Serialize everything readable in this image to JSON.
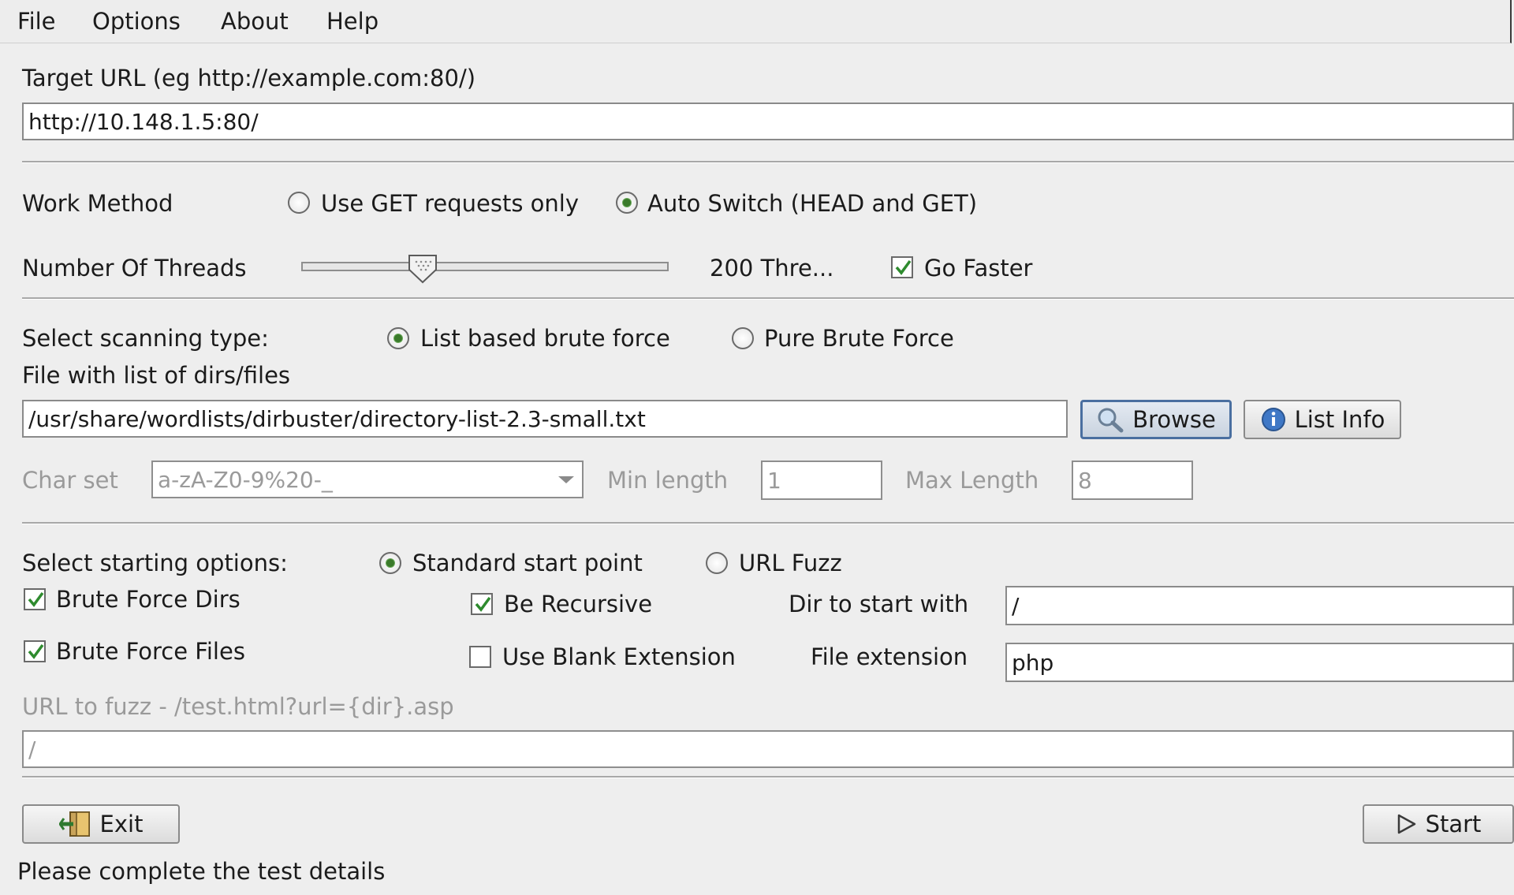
{
  "menu": [
    "File",
    "Options",
    "About",
    "Help"
  ],
  "target": {
    "label": "Target URL (eg http://example.com:80/)",
    "value": "http://10.148.1.5:80/"
  },
  "work_method": {
    "label": "Work Method",
    "options": [
      "Use GET requests only",
      "Auto Switch (HEAD and GET)"
    ],
    "selected": "Auto Switch (HEAD and GET)"
  },
  "threads": {
    "label": "Number Of Threads",
    "value_text": "200 Thre...",
    "slider_fraction": 0.33,
    "go_faster_label": "Go Faster",
    "go_faster_checked": true
  },
  "scan_type": {
    "label": "Select scanning type:",
    "options": [
      "List based brute force",
      "Pure Brute Force"
    ],
    "selected": "List based brute force"
  },
  "wordlist": {
    "label": "File with list of dirs/files",
    "value": "/usr/share/wordlists/dirbuster/directory-list-2.3-small.txt",
    "browse_label": "Browse",
    "list_info_label": "List Info"
  },
  "charset": {
    "label": "Char set",
    "value": "a-zA-Z0-9%20-_",
    "min_label": "Min length",
    "min_value": "1",
    "max_label": "Max Length",
    "max_value": "8"
  },
  "start_options": {
    "label": "Select starting options:",
    "options": [
      "Standard start point",
      "URL Fuzz"
    ],
    "selected": "Standard start point",
    "brute_dirs_label": "Brute Force Dirs",
    "brute_dirs_checked": true,
    "brute_files_label": "Brute Force Files",
    "brute_files_checked": true,
    "recursive_label": "Be Recursive",
    "recursive_checked": true,
    "blank_ext_label": "Use Blank Extension",
    "blank_ext_checked": false,
    "dir_start_label": "Dir to start with",
    "dir_start_value": "/",
    "file_ext_label": "File extension",
    "file_ext_value": "php"
  },
  "fuzz": {
    "label": "URL to fuzz - /test.html?url={dir}.asp",
    "value": "/"
  },
  "buttons": {
    "exit": "Exit",
    "start": "Start"
  },
  "status": "Please complete the test details",
  "colors": {
    "radio_dot": "#3a7a2a",
    "check_mark": "#2e8b2e",
    "focus_border": "#4a6fa0"
  }
}
